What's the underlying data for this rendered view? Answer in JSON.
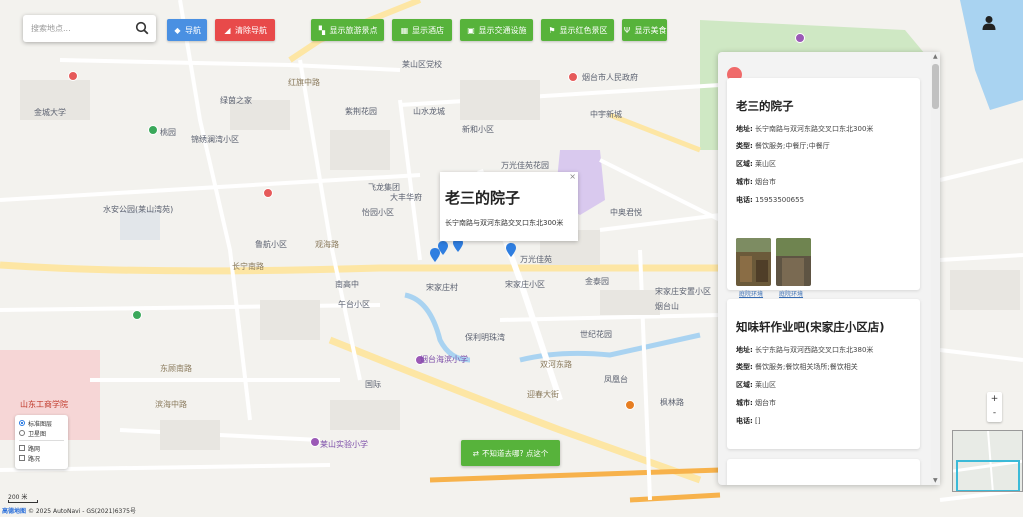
{
  "search": {
    "placeholder": "搜索地点..."
  },
  "toolbar": {
    "nav": "导航",
    "clear_nav": "清除导航",
    "scenic": "显示旅游景点",
    "hotel": "显示酒店",
    "transit": "显示交通设施",
    "red": "显示红色景区",
    "food": "显示美食"
  },
  "popup": {
    "title": "老三的院子",
    "address": "长宁南路与双河东路交叉口东北300米",
    "close": "×"
  },
  "panel": {
    "cards": [
      {
        "title": "老三的院子",
        "address_label": "地址:",
        "address": "长宁南路与双河东路交叉口东北300米",
        "type_label": "类型:",
        "type": "餐饮服务;中餐厅;中餐厅",
        "district_label": "区域:",
        "district": "莱山区",
        "city_label": "城市:",
        "city": "烟台市",
        "phone_label": "电话:",
        "phone": "15953500655",
        "photos": [
          "庭院环境",
          "庭院环境"
        ]
      },
      {
        "title": "知味轩作业吧(宋家庄小区店)",
        "address_label": "地址:",
        "address": "长宁东路与双河西路交叉口东北380米",
        "type_label": "类型:",
        "type": "餐饮服务;餐饮相关场所;餐饮相关",
        "district_label": "区域:",
        "district": "莱山区",
        "city_label": "城市:",
        "city": "烟台市",
        "phone_label": "电话:",
        "phone": "[]"
      }
    ]
  },
  "layers": {
    "standard": "标准图层",
    "satellite": "卫星图",
    "roadnet": "路网",
    "traffic": "路况"
  },
  "toast": {
    "text": "不知道去哪? 点这个"
  },
  "scale": {
    "label": "200 米"
  },
  "copyright": {
    "logo": "高德地图",
    "text": "© 2025 AutoNavi - GS(2021)6375号"
  },
  "zoom": {
    "in": "+",
    "out": "-"
  },
  "map_labels": {
    "l1": "莱山区党校",
    "l2": "烟台市人民政府",
    "l3": "金城大学",
    "l4": "中宇新城",
    "l5": "绿茵之家",
    "l6": "紫荆花园",
    "l7": "红旗中路",
    "l8": "山水龙城",
    "l9": "新和小区",
    "l10": "大丰华府",
    "l11": "飞龙集团",
    "l12": "万光佳苑花园",
    "l13": "中奥君悦",
    "l14": "怡园小区",
    "l15": "锦绣澜湾小区",
    "l16": "桃园",
    "l17": "水安公园(莱山湾苑)",
    "l18": "鲁航小区",
    "l19": "宋家庄村",
    "l20": "观海路",
    "l21": "万光佳苑",
    "l22": "金泰园",
    "l23": "东顾南路",
    "l24": "宋家庄小区",
    "l25": "南高中",
    "l26": "午台小区",
    "l27": "保利明珠湾",
    "l28": "宋家庄安置小区",
    "l29": "烟台山",
    "l30": "世纪花园",
    "l31": "烟台海滨小学",
    "l32": "双河东路",
    "l33": "山东工商学院",
    "l34": "长宁南路",
    "l35": "迎春大街",
    "l36": "滨海中路",
    "l37": "枫林路",
    "l38": "莱山实验小学",
    "l39": "国际",
    "l40": "凤凰台"
  },
  "colors": {
    "primary_blue": "#4a90e2",
    "danger_red": "#e84a4a",
    "success_green": "#57b33b",
    "panel_dot": "#f06a6a"
  }
}
